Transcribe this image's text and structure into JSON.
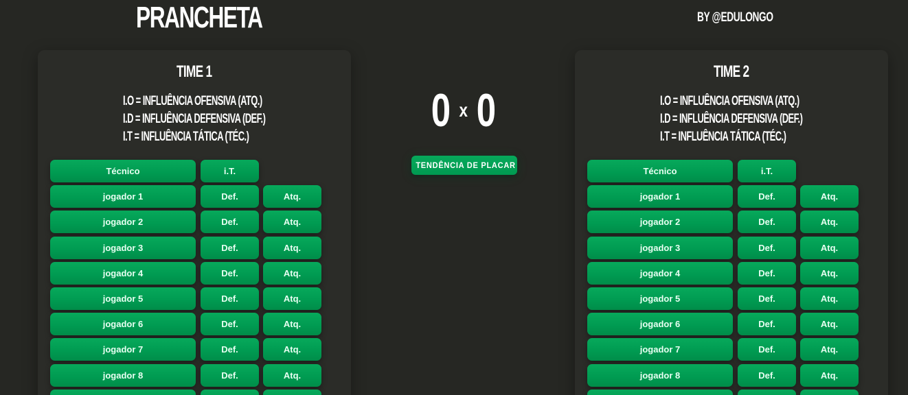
{
  "header": {
    "title": "PRANCHETA",
    "byline": "BY @EDULONGO"
  },
  "scoreboard": {
    "home_score": "0",
    "separator": "x",
    "away_score": "0",
    "trend_button_label": "TENDÊNCIA DE PLACAR"
  },
  "teams": [
    {
      "name": "TIME 1",
      "legend": [
        "I.O = INFLUÊNCIA OFENSIVA (ATQ.)",
        "I.D = INFLUÊNCIA DEFENSIVA (DEF.)",
        "I.T = INFLUÊNCIA TÁTICA (TÉC.)"
      ],
      "coach": {
        "label": "Técnico",
        "it_label": "i.T."
      },
      "players": [
        {
          "name": "jogador 1",
          "def": "Def.",
          "atq": "Atq."
        },
        {
          "name": "jogador 2",
          "def": "Def.",
          "atq": "Atq."
        },
        {
          "name": "jogador 3",
          "def": "Def.",
          "atq": "Atq."
        },
        {
          "name": "jogador 4",
          "def": "Def.",
          "atq": "Atq."
        },
        {
          "name": "jogador 5",
          "def": "Def.",
          "atq": "Atq."
        },
        {
          "name": "jogador 6",
          "def": "Def.",
          "atq": "Atq."
        },
        {
          "name": "jogador 7",
          "def": "Def.",
          "atq": "Atq."
        },
        {
          "name": "jogador 8",
          "def": "Def.",
          "atq": "Atq."
        },
        {
          "name": "",
          "def": "",
          "atq": ""
        }
      ]
    },
    {
      "name": "TIME 2",
      "legend": [
        "I.O = INFLUÊNCIA OFENSIVA (ATQ.)",
        "I.D = INFLUÊNCIA DEFENSIVA (DEF.)",
        "I.T = INFLUÊNCIA TÁTICA (TÉC.)"
      ],
      "coach": {
        "label": "Técnico",
        "it_label": "i.T."
      },
      "players": [
        {
          "name": "jogador 1",
          "def": "Def.",
          "atq": "Atq."
        },
        {
          "name": "jogador 2",
          "def": "Def.",
          "atq": "Atq."
        },
        {
          "name": "jogador 3",
          "def": "Def.",
          "atq": "Atq."
        },
        {
          "name": "jogador 4",
          "def": "Def.",
          "atq": "Atq."
        },
        {
          "name": "jogador 5",
          "def": "Def.",
          "atq": "Atq."
        },
        {
          "name": "jogador 6",
          "def": "Def.",
          "atq": "Atq."
        },
        {
          "name": "jogador 7",
          "def": "Def.",
          "atq": "Atq."
        },
        {
          "name": "jogador 8",
          "def": "Def.",
          "atq": "Atq."
        },
        {
          "name": "",
          "def": "",
          "atq": ""
        }
      ]
    }
  ],
  "colors": {
    "background": "#262723",
    "panel": "#2b2c28",
    "button_green": "#009a51",
    "text": "#ffffff"
  }
}
